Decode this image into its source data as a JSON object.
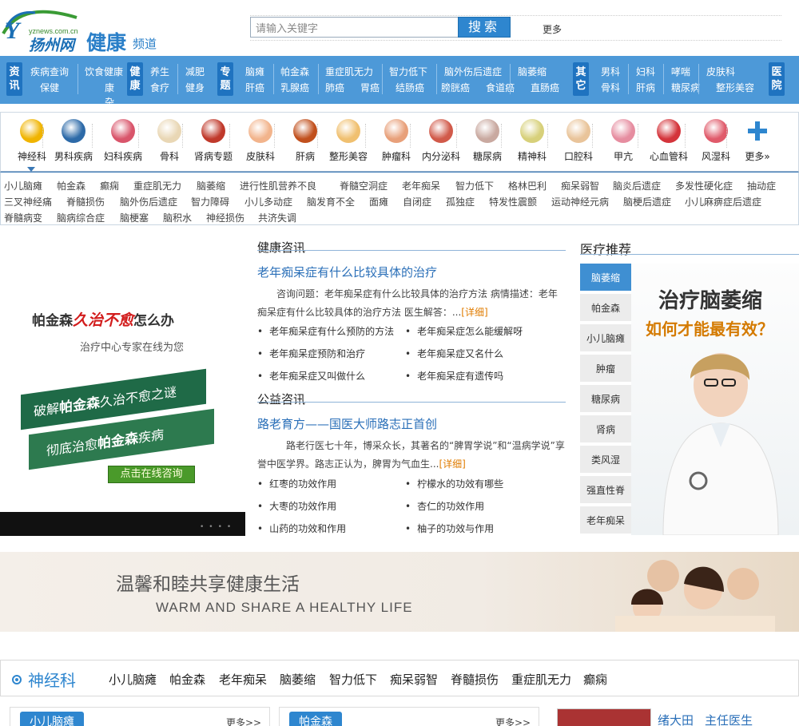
{
  "header": {
    "logo_url_text": "yznews.com.cn",
    "logo_site": "扬州网",
    "logo_channel": "健康",
    "logo_channel_suffix": "频道",
    "search_placeholder": "请输入关键字",
    "search_button": "搜索",
    "more": "更多"
  },
  "nav": {
    "group1_badge": "资讯",
    "group1": [
      "疾病查询",
      "饮食健康",
      "保健",
      "康杂"
    ],
    "group2_badge": "健康",
    "group2": [
      "养生",
      "减肥",
      "食疗",
      "健身"
    ],
    "group3_badge": "专题",
    "group3_row1": [
      "脑瘫",
      "帕金森",
      "重症肌无力",
      "智力低下",
      "脑外伤后遗症",
      "脑萎缩"
    ],
    "group3_row2": [
      "肝癌",
      "乳腺癌",
      "肺癌",
      "胃癌",
      "结肠癌",
      "膀胱癌",
      "食道癌",
      "直肠癌"
    ],
    "group4_badge": "其它",
    "group4_row1": [
      "男科",
      "妇科",
      "哮喘",
      "皮肤科"
    ],
    "group4_row2": [
      "骨科",
      "肝病",
      "糖尿病",
      "整形美容"
    ],
    "group5_badge": "医院"
  },
  "categories": [
    {
      "label": "神经科",
      "color": "#f0b400"
    },
    {
      "label": "男科疾病",
      "color": "#2d6aa8"
    },
    {
      "label": "妇科疾病",
      "color": "#d9556b"
    },
    {
      "label": "骨科",
      "color": "#e9d7b5"
    },
    {
      "label": "肾病专题",
      "color": "#c0392b"
    },
    {
      "label": "皮肤科",
      "color": "#f2b48c"
    },
    {
      "label": "肝病",
      "color": "#c1501d"
    },
    {
      "label": "整形美容",
      "color": "#f0c070"
    },
    {
      "label": "肿瘤科",
      "color": "#e8a07a"
    },
    {
      "label": "内分泌科",
      "color": "#d15a4a"
    },
    {
      "label": "糖尿病",
      "color": "#c9a9a0"
    },
    {
      "label": "精神科",
      "color": "#d7d07a"
    },
    {
      "label": "口腔科",
      "color": "#e9c49a"
    },
    {
      "label": "甲亢",
      "color": "#e68da0"
    },
    {
      "label": "心血管科",
      "color": "#d4343b"
    },
    {
      "label": "风湿科",
      "color": "#e05a6a"
    },
    {
      "label": "更多»",
      "color": "#2e86cf"
    }
  ],
  "subcategories": {
    "row1": [
      "小儿脑瘫",
      "帕金森",
      "癫痫",
      "重症肌无力",
      "脑萎缩",
      "进行性肌营养不良",
      "脊髓空洞症",
      "老年痴呆",
      "智力低下",
      "格林巴利",
      "痴呆弱智",
      "脑炎后遗症",
      "多发性硬化症",
      "抽动症"
    ],
    "row2": [
      "三叉神经痛",
      "脊髓损伤",
      "脑外伤后遗症",
      "智力障碍",
      "小儿多动症",
      "脑发育不全",
      "面瘫",
      "自闭症",
      "孤独症",
      "特发性震颤",
      "运动神经元病",
      "脑梗后遗症",
      "小儿麻痹症后遗症"
    ],
    "row3": [
      "脊髓病变",
      "脑病综合症",
      "脑梗塞",
      "脑积水",
      "神经损伤",
      "共济失调"
    ]
  },
  "left_ad": {
    "line1a": "帕金森",
    "line1b": "久治不愈",
    "line1c": "怎么办",
    "line2": "治疗中心专家在线为您",
    "box1a": "破解",
    "box1b": "帕金森",
    "box1c": "久治不愈之谜",
    "box2a": "彻底治愈",
    "box2b": "帕金森",
    "box2c": "疾病",
    "button": "点击在线咨询"
  },
  "health_news": {
    "heading": "健康咨讯",
    "headline": "老年痴呆症有什么比较具体的治疗",
    "para": "咨询问题：老年痴呆症有什么比较具体的治疗方法 病情描述：老年痴呆症有什么比较具体的治疗方法 医生解答：...",
    "detail": "[详细]",
    "links_left": [
      "老年痴呆症有什么预防的方法",
      "老年痴呆症预防和治疗",
      "老年痴呆症又叫做什么"
    ],
    "links_right": [
      "老年痴呆症怎么能缓解呀",
      "老年痴呆症又名什么",
      "老年痴呆症有遗传吗"
    ]
  },
  "public_news": {
    "heading": "公益咨讯",
    "headline": "路老育方——国医大师路志正首创",
    "para": "路老行医七十年，博采众长，其著名的“脾胃学说”和“温病学说”享誉中医学界。路志正认为，脾胃为气血生...",
    "detail": "[详细]",
    "links_left": [
      "红枣的功效作用",
      "大枣的功效作用",
      "山药的功效和作用"
    ],
    "links_right": [
      "柠檬水的功效有哪些",
      "杏仁的功效作用",
      "柚子的功效与作用"
    ]
  },
  "recommend": {
    "heading": "医疗推荐",
    "items": [
      "脑萎缩",
      "帕金森",
      "小儿脑瘫",
      "肿瘤",
      "糖尿病",
      "肾病",
      "类风湿",
      "强直性脊",
      "老年痴呆"
    ],
    "img_title1": "治疗脑萎缩",
    "img_title2": "如何才能最有效？"
  },
  "banner": {
    "title": "温馨和睦共享健康生活",
    "subtitle": "WARM AND SHARE A HEALTHY LIFE"
  },
  "bottom": {
    "heading": "神经科",
    "tabs": [
      "小儿脑瘫",
      "帕金森",
      "老年痴呆",
      "脑萎缩",
      "智力低下",
      "痴呆弱智",
      "脊髓损伤",
      "重症肌无力",
      "癫痫"
    ],
    "card1_tab": "小儿脑瘫",
    "card1_more": "更多>>",
    "card2_tab": "帕金森",
    "card2_more": "更多>>",
    "doctor_name": "绪大田",
    "doctor_title": "主任医生"
  }
}
